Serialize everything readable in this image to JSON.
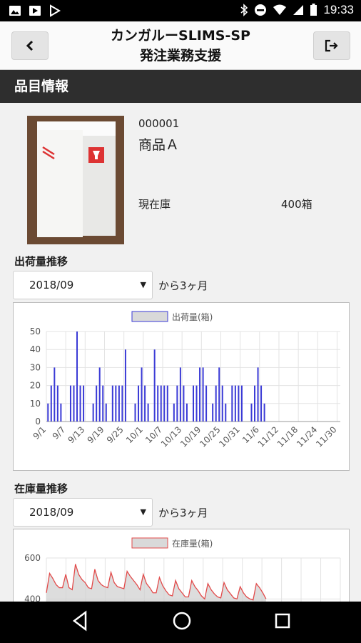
{
  "status_bar": {
    "time": "19:33"
  },
  "header": {
    "title_line1": "カンガルーSLIMS-SP",
    "title_line2": "発注業務支援"
  },
  "section": {
    "title": "品目情報"
  },
  "product": {
    "code": "000001",
    "name": "商品Ａ",
    "stock_label": "現在庫",
    "stock_value": "400箱"
  },
  "shipment_section": {
    "title": "出荷量推移",
    "select_value": "2018/09",
    "range_label": "から3ヶ月"
  },
  "inventory_section": {
    "title": "在庫量推移",
    "select_value": "2018/09",
    "range_label": "から3ヶ月"
  },
  "colors": {
    "bar": "#3a3ad6",
    "line": "#e24a4a",
    "area": "#cfcfcf"
  },
  "chart_data": [
    {
      "type": "bar",
      "legend": "出荷量(箱)",
      "ylim": [
        0,
        50
      ],
      "yticks": [
        0,
        10,
        20,
        30,
        40,
        50
      ],
      "xtick_labels": [
        "9/1",
        "9/7",
        "9/13",
        "9/19",
        "9/25",
        "10/1",
        "10/7",
        "10/13",
        "10/19",
        "10/25",
        "10/31",
        "11/6",
        "11/12",
        "11/18",
        "11/24",
        "11/30"
      ],
      "series": [
        {
          "values": [
            10,
            20,
            30,
            20,
            10,
            0,
            0,
            20,
            20,
            50,
            20,
            20,
            0,
            0,
            10,
            20,
            30,
            20,
            10,
            0,
            20,
            20,
            20,
            20,
            40,
            0,
            0,
            10,
            20,
            30,
            20,
            10,
            0,
            40,
            20,
            20,
            20,
            20,
            0,
            10,
            20,
            30,
            20,
            10,
            0,
            20,
            20,
            30,
            30,
            20,
            0,
            10,
            20,
            30,
            20,
            10,
            0,
            20,
            20,
            20,
            20,
            0,
            0,
            10,
            20,
            30,
            20,
            10,
            0,
            0,
            0,
            0,
            0,
            0,
            0,
            0,
            0,
            0,
            0,
            0,
            0,
            0,
            0,
            0,
            0,
            0,
            0,
            0,
            0,
            0,
            0
          ]
        }
      ]
    },
    {
      "type": "area",
      "legend": "在庫量(箱)",
      "ylim": [
        300,
        600
      ],
      "yticks": [
        400,
        600
      ],
      "series": [
        {
          "values": [
            430,
            525,
            500,
            470,
            455,
            455,
            520,
            455,
            445,
            570,
            520,
            495,
            480,
            455,
            450,
            545,
            490,
            470,
            460,
            455,
            530,
            480,
            460,
            455,
            450,
            535,
            510,
            490,
            470,
            445,
            520,
            475,
            455,
            430,
            430,
            505,
            465,
            440,
            420,
            415,
            490,
            450,
            430,
            410,
            410,
            490,
            460,
            440,
            415,
            400,
            475,
            445,
            425,
            410,
            405,
            480,
            445,
            425,
            405,
            400,
            460,
            430,
            410,
            400,
            395,
            475,
            455,
            430,
            400,
            null
          ]
        }
      ]
    }
  ]
}
